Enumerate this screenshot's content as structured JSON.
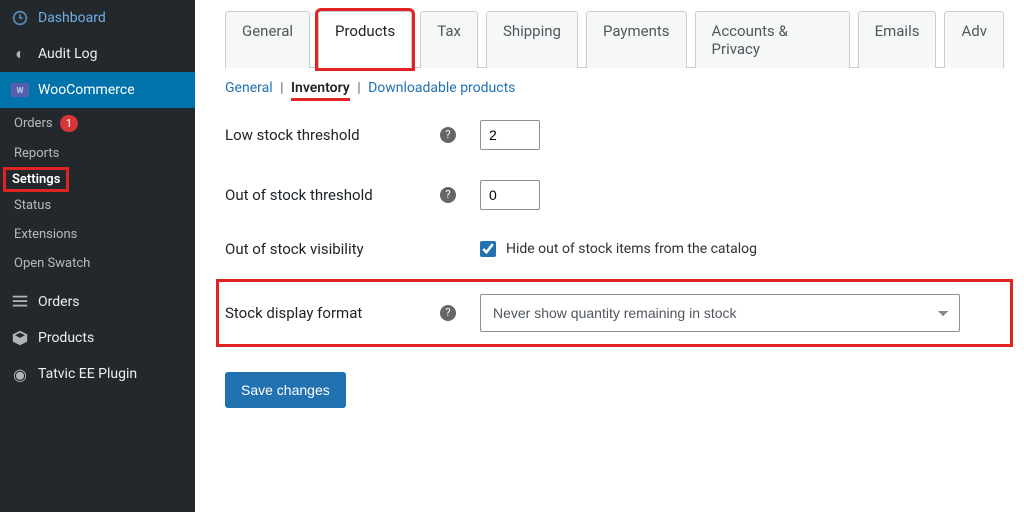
{
  "sidebar": {
    "dashboard": "Dashboard",
    "audit_log": "Audit Log",
    "woocommerce": "WooCommerce",
    "sub": {
      "orders": "Orders",
      "orders_badge": "1",
      "reports": "Reports",
      "settings": "Settings",
      "status": "Status",
      "extensions": "Extensions",
      "open_swatch": "Open Swatch"
    },
    "orders": "Orders",
    "products": "Products",
    "tatvic": "Tatvic EE Plugin"
  },
  "tabs": {
    "general": "General",
    "products": "Products",
    "tax": "Tax",
    "shipping": "Shipping",
    "payments": "Payments",
    "accounts": "Accounts & Privacy",
    "emails": "Emails",
    "adv": "Adv"
  },
  "subnav": {
    "general": "General",
    "inventory": "Inventory",
    "downloadable": "Downloadable products",
    "sep": "|"
  },
  "form": {
    "low_stock_label": "Low stock threshold",
    "low_stock_value": "2",
    "out_stock_label": "Out of stock threshold",
    "out_stock_value": "0",
    "visibility_label": "Out of stock visibility",
    "visibility_check": "Hide out of stock items from the catalog",
    "display_label": "Stock display format",
    "display_value": "Never show quantity remaining in stock",
    "save": "Save changes",
    "help": "?"
  }
}
